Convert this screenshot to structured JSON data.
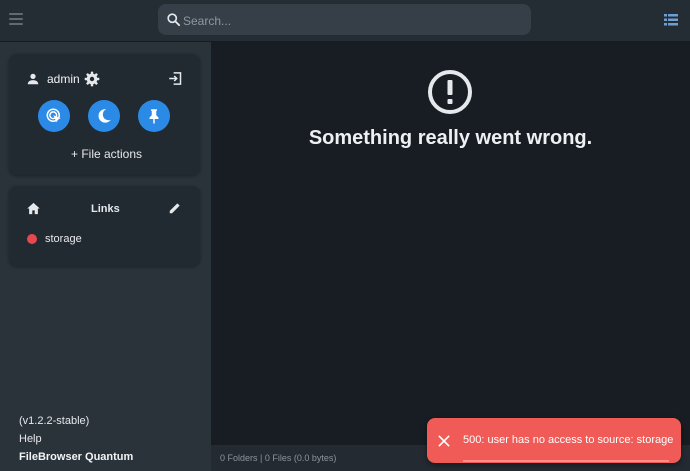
{
  "header": {
    "search_placeholder": "Search...",
    "menu_icon": "hamburger-menu-icon",
    "view_icon": "list-view-icon"
  },
  "sidebar": {
    "user": {
      "name": "admin",
      "icons": [
        "person-icon",
        "gear-icon",
        "logout-icon"
      ],
      "quick_buttons": [
        "touch-icon",
        "moon-icon",
        "pin-icon"
      ],
      "file_actions_label": "+ File actions"
    },
    "links": {
      "title": "Links",
      "items": [
        {
          "label": "storage",
          "status_color": "#e5484d"
        }
      ]
    },
    "footer": {
      "version": "(v1.2.2-stable)",
      "help": "Help",
      "app_name": "FileBrowser Quantum"
    }
  },
  "main": {
    "error_icon": "exclamation-circle-icon",
    "error_title": "Something really went wrong."
  },
  "status": {
    "summary": "0 Folders | 0 Files (0.0 bytes)"
  },
  "toast": {
    "message": "500: user has no access to source: storage",
    "background": "#f05a57"
  },
  "colors": {
    "accent": "#2b8ae6",
    "background": "#171d22",
    "sidebar": "#2a323a"
  }
}
